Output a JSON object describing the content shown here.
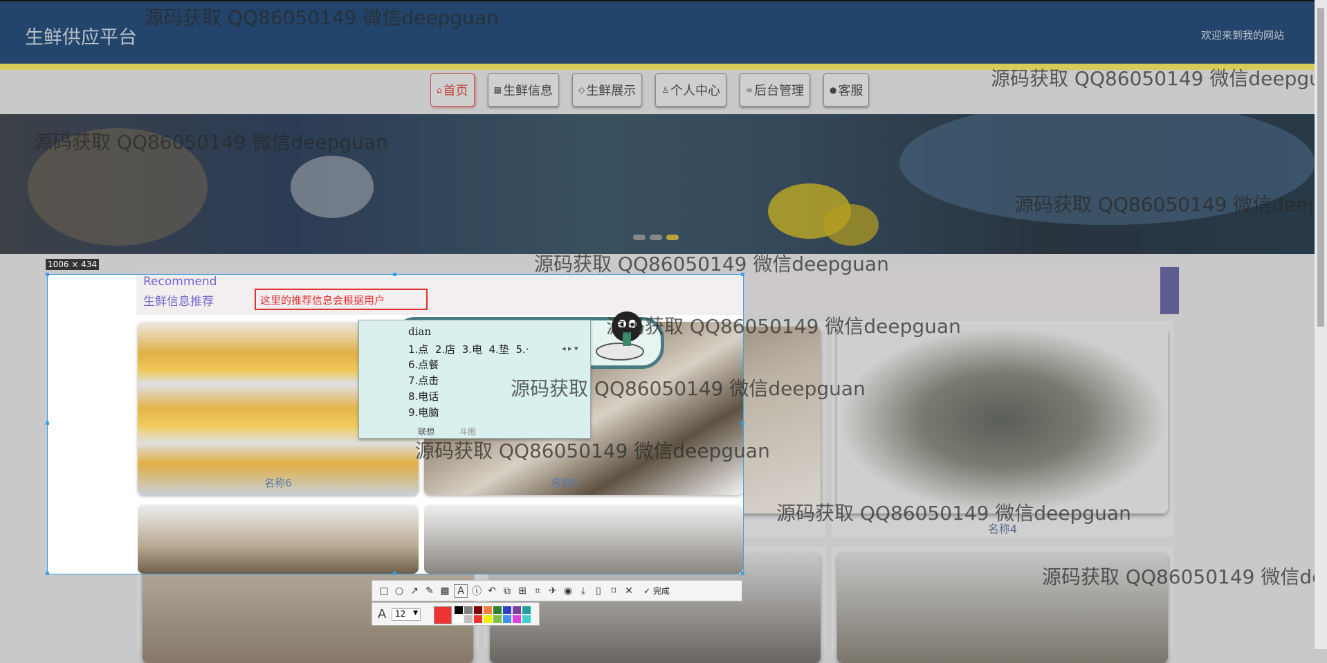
{
  "header": {
    "title": "生鲜供应平台",
    "welcome": "欢迎来到我的网站"
  },
  "nav": [
    {
      "label": "首页",
      "icon": "home-icon"
    },
    {
      "label": "生鲜信息",
      "icon": "grid-icon"
    },
    {
      "label": "生鲜展示",
      "icon": "tag-icon"
    },
    {
      "label": "个人中心",
      "icon": "user-icon"
    },
    {
      "label": "后台管理",
      "icon": "link-icon"
    },
    {
      "label": "客服",
      "icon": "chat-icon"
    }
  ],
  "recommend": {
    "title_en": "Recommend",
    "title_zh": "生鲜信息推荐"
  },
  "products": [
    {
      "name": "名称6"
    },
    {
      "name": "名称5"
    },
    {
      "name": "名称4"
    }
  ],
  "screenshot_tool": {
    "size_label": "1006 × 434",
    "text_input": "这里的推荐信息会根据用户",
    "font_size": "12",
    "done_label": "完成",
    "current_color": "#ee3333",
    "palette": [
      "#000000",
      "#808080",
      "#800000",
      "#f08040",
      "#308030",
      "#3040c0",
      "#8040a0",
      "#20a0a0",
      "#ffffff",
      "#c0c0c0",
      "#ee3333",
      "#f0f000",
      "#80c040",
      "#4090f0",
      "#e040e0",
      "#40d0d0"
    ]
  },
  "ime": {
    "pinyin": "dian",
    "candidates": [
      "1.点",
      "2.店",
      "3.电",
      "4.垫",
      "5.·"
    ],
    "more": [
      "6.点餐",
      "7.点击",
      "8.电话",
      "9.电脑"
    ],
    "footer_left": "联想",
    "footer_right": "斗图"
  },
  "watermark": "源码获取 QQ86050149 微信deepguan"
}
